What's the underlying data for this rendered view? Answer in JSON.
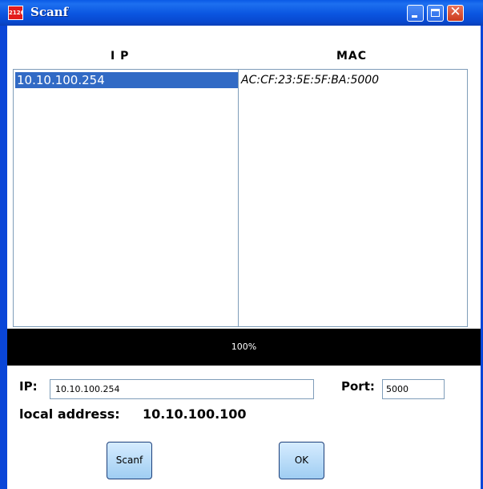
{
  "window": {
    "title": "Scanf",
    "icon": "app-logo-icon",
    "icon_text": "2126",
    "controls": {
      "minimize": "minimize-icon",
      "maximize": "maximize-icon",
      "close": "close-icon",
      "close_glyph": "✕"
    }
  },
  "table": {
    "columns": [
      "I P",
      "MAC"
    ],
    "ip_items": [
      "10.10.100.254"
    ],
    "mac_items": [
      "AC:CF:23:5E:5F:BA:5000"
    ],
    "selected_index": 0
  },
  "progress": {
    "value": 1.0,
    "label": "100%"
  },
  "form": {
    "ip_label": "IP:",
    "ip_value": "10.10.100.254",
    "port_label": "Port:",
    "port_value": "5000",
    "local_address_label": "local address:",
    "local_address_value": "10.10.100.100"
  },
  "buttons": {
    "scanf": "Scanf",
    "ok": "OK"
  },
  "colors": {
    "titlebar": "#0a55e0",
    "selection": "#316ac5",
    "progress_bg": "#000000",
    "button_face": "#b8dcf8"
  }
}
